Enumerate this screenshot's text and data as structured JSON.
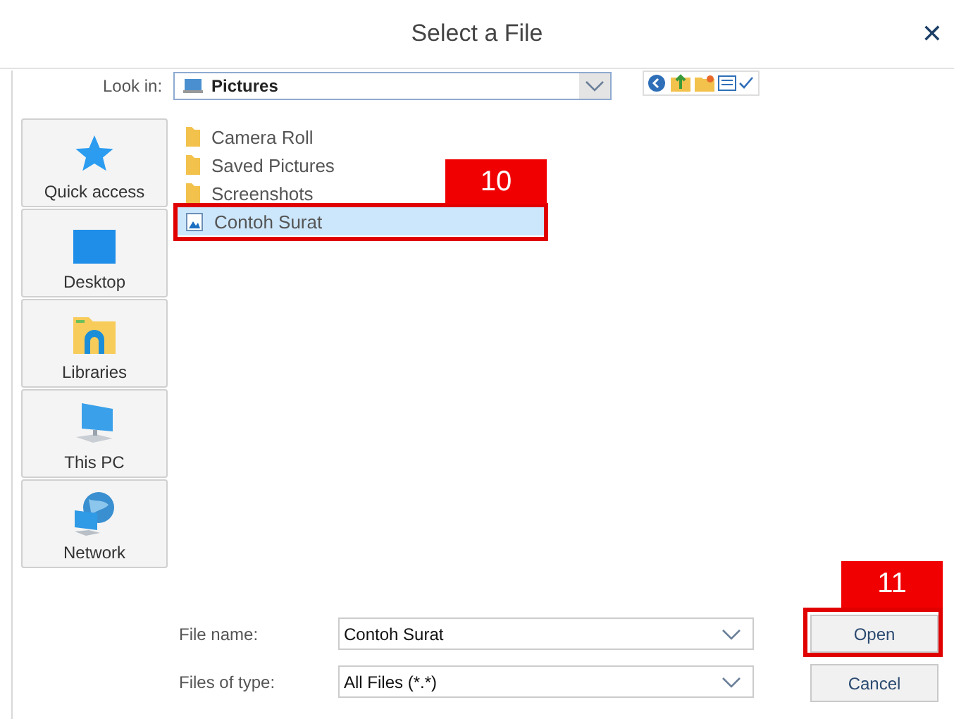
{
  "window": {
    "title": "Select a File",
    "close": "✕"
  },
  "look_in": {
    "label": "Look in:",
    "value": "Pictures"
  },
  "places": [
    {
      "label": "Quick access",
      "kind": "star"
    },
    {
      "label": "Desktop",
      "kind": "desktop"
    },
    {
      "label": "Libraries",
      "kind": "libraries"
    },
    {
      "label": "This PC",
      "kind": "pc"
    },
    {
      "label": "Network",
      "kind": "network"
    }
  ],
  "files": [
    {
      "name": "Camera Roll",
      "kind": "folder",
      "selected": false
    },
    {
      "name": "Saved Pictures",
      "kind": "folder",
      "selected": false
    },
    {
      "name": "Screenshots",
      "kind": "folder",
      "selected": false
    },
    {
      "name": "Contoh Surat",
      "kind": "image",
      "selected": true
    }
  ],
  "file_name": {
    "label": "File name:",
    "value": "Contoh Surat"
  },
  "file_type": {
    "label": "Files of type:",
    "value": "All Files (*.*)"
  },
  "buttons": [
    {
      "label": "Open"
    },
    {
      "label": "Cancel"
    }
  ],
  "callouts": [
    {
      "label": "10",
      "kind": "file"
    },
    {
      "label": "11",
      "kind": "button"
    }
  ]
}
